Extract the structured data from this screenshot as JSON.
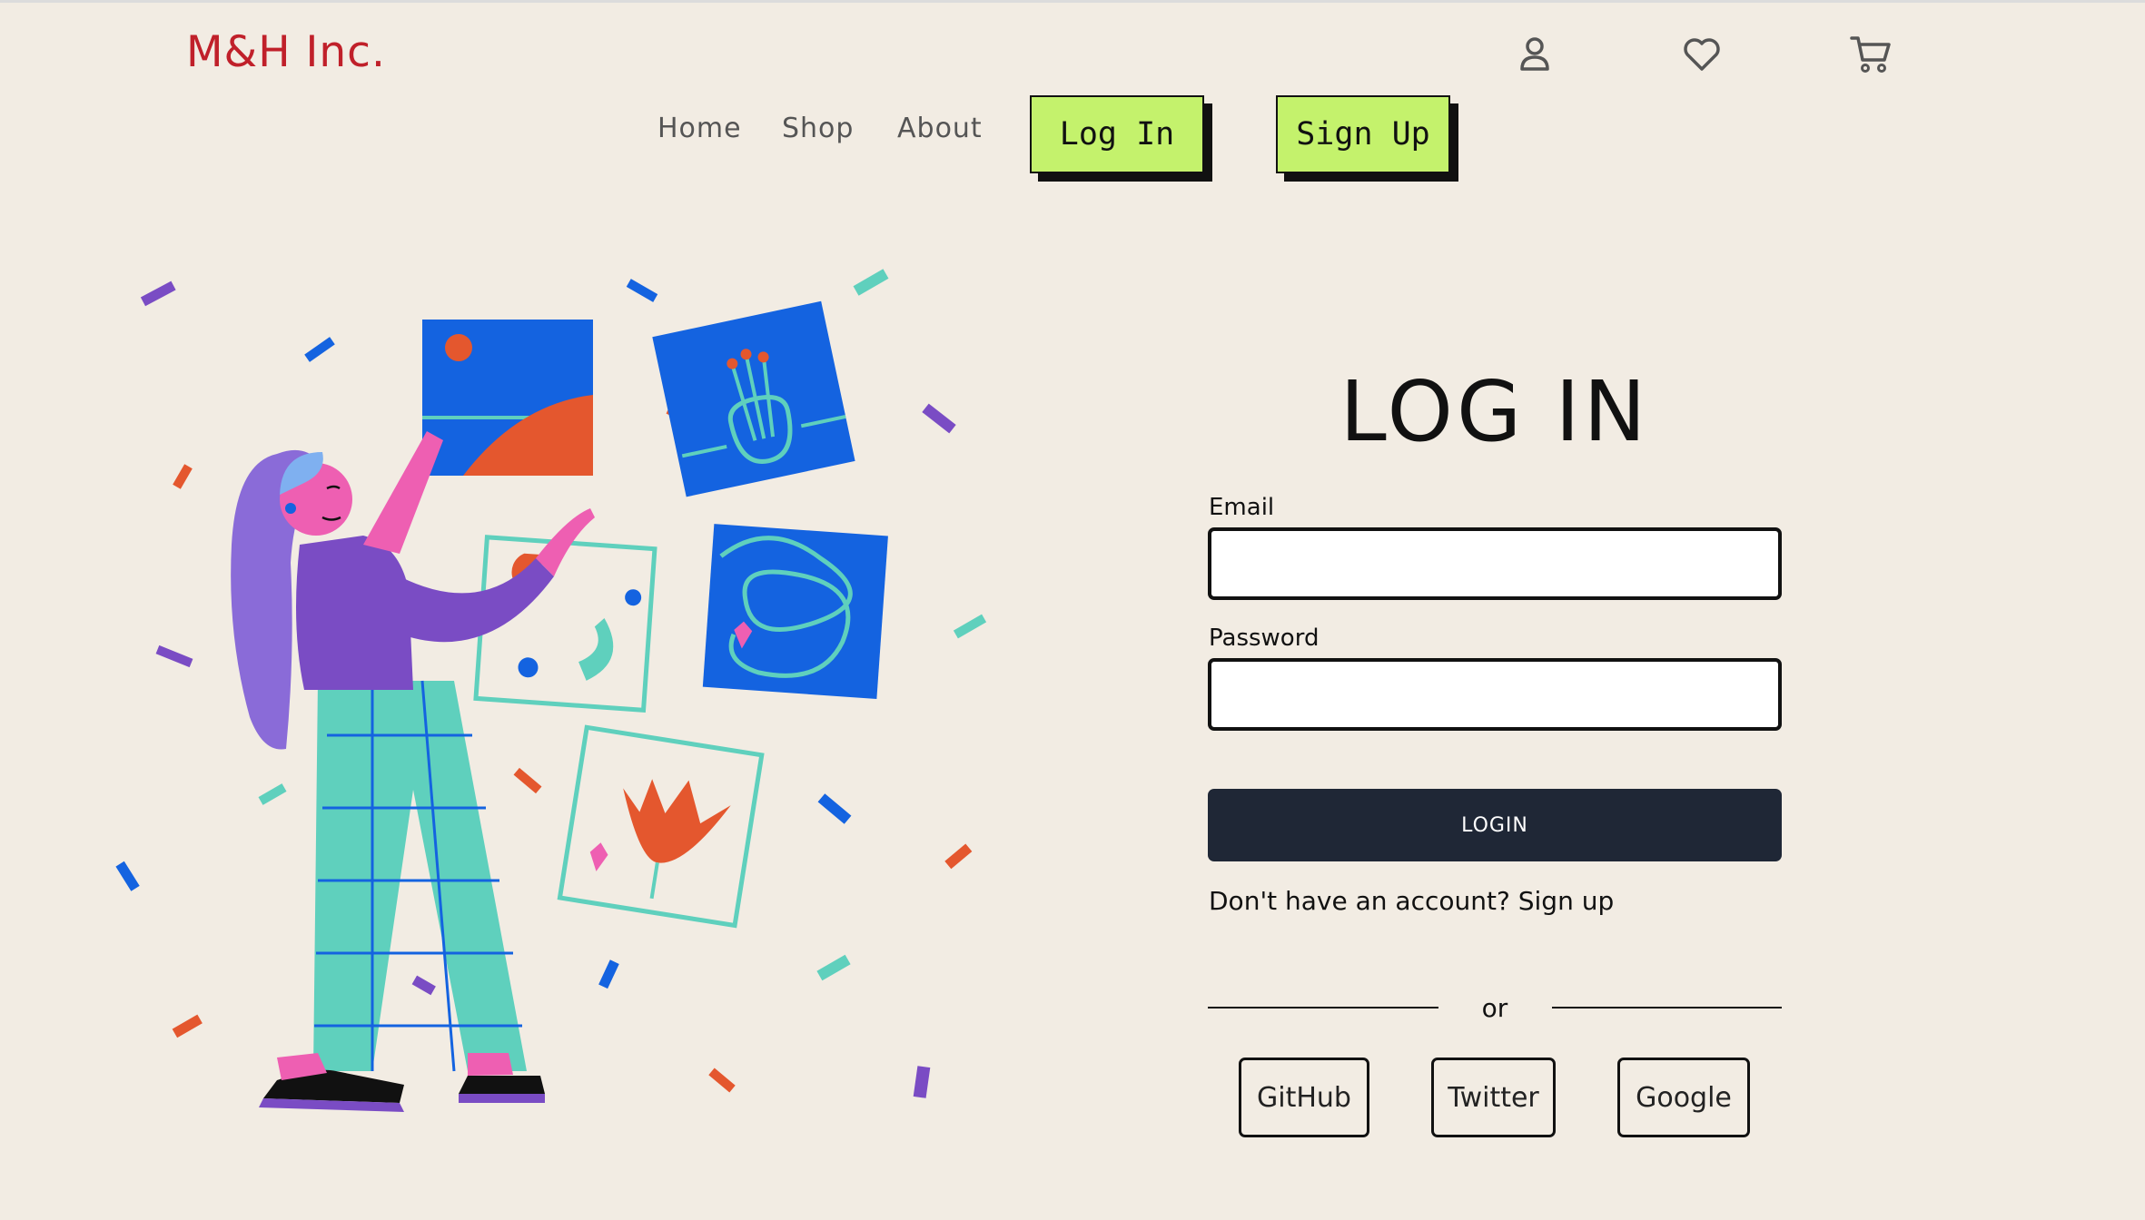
{
  "brand": "M&H Inc.",
  "header_icons": [
    "user-icon",
    "heart-icon",
    "cart-icon"
  ],
  "nav": {
    "home": "Home",
    "shop": "Shop",
    "about": "About",
    "login": "Log In",
    "signup": "Sign Up"
  },
  "form": {
    "title": "LOG IN",
    "email_label": "Email",
    "email_value": "",
    "password_label": "Password",
    "password_value": "",
    "submit": "LOGIN",
    "signup_prompt": "Don't have an account?",
    "signup_link": "Sign up",
    "or": "or",
    "social": [
      "GitHub",
      "Twitter",
      "Google"
    ]
  },
  "colors": {
    "background": "#f2ece3",
    "brand": "#c0202a",
    "cta": "#c4f26c",
    "submit": "#1f2736",
    "art_blue": "#1463e0",
    "art_teal": "#5fd0bd",
    "art_orange": "#e4572e",
    "art_purple": "#7a4cc4",
    "art_pink": "#ee5fb2"
  }
}
